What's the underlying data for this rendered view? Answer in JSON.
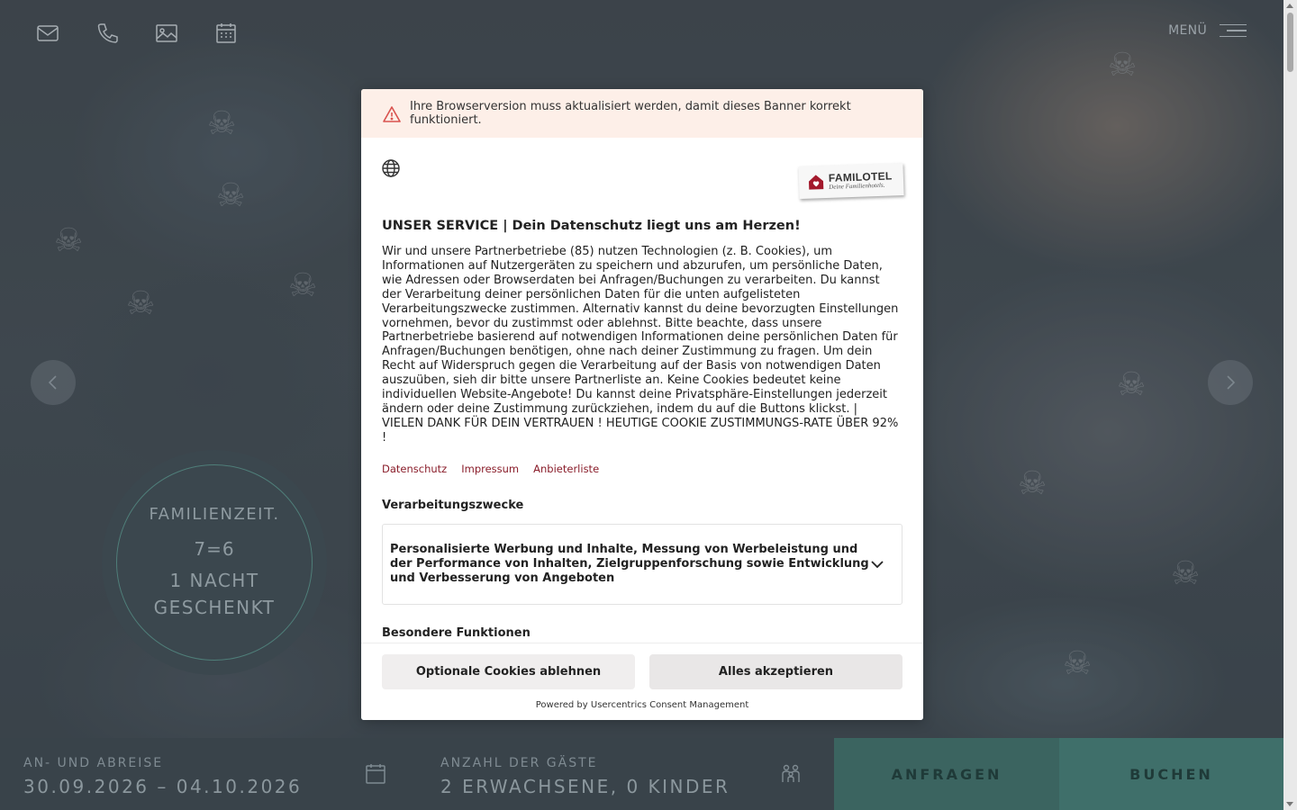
{
  "page": {
    "menu_label": "MENÜ"
  },
  "promo": {
    "title": "FAMILIENZEIT.",
    "equation": "7=6",
    "line1": "1 NACHT",
    "line2": "GESCHENKT"
  },
  "booking": {
    "dates_label": "AN- UND ABREISE",
    "dates_value": "30.09.2026 – 04.10.2026",
    "guests_label": "ANZAHL DER GÄSTE",
    "guests_value": "2 ERWACHSENE, 0 KINDER",
    "inquire_label": "ANFRAGEN",
    "book_label": "BUCHEN"
  },
  "consent": {
    "warning": "Ihre Browserversion muss aktualisiert werden, damit dieses Banner korrekt funktioniert.",
    "logo_name": "FAMILOTEL",
    "logo_tagline": "Deine Familienhotels.",
    "title": "UNSER SERVICE | Dein Datenschutz liegt uns am Herzen!",
    "text": "Wir und unsere Partnerbetriebe (85) nutzen Technologien (z. B. Cookies), um Informationen auf Nutzergeräten zu speichern und abzurufen, um persönliche Daten, wie Adressen oder Browserdaten bei Anfragen/Buchungen zu verarbeiten. Du kannst der Verarbeitung deiner persönlichen Daten für die unten aufgelisteten Verarbeitungszwecke zustimmen. Alternativ kannst du deine bevorzugten Einstellungen vornehmen, bevor du zustimmst oder ablehnst. Bitte beachte, dass unsere Partnerbetriebe basierend auf notwendigen Informationen deine persönlichen Daten für Anfragen/Buchungen benötigen, ohne nach deiner Zustimmung zu fragen. Um dein Recht auf Widerspruch gegen die Verarbeitung auf der Basis von notwendigen Daten auszuüben, sieh dir bitte unsere Partnerliste an. Keine Cookies bedeutet keine individuellen Website-Angebote! Du kannst deine Privatsphäre-Einstellungen jederzeit ändern oder deine Zustimmung zurückziehen, indem du auf die Buttons klickst. | VIELEN DANK FÜR DEIN VERTRAUEN ! HEUTIGE COOKIE ZUSTIMMUNGS-RATE ÜBER 92% !",
    "links": {
      "privacy": "Datenschutz",
      "imprint": "Impressum",
      "vendors": "Anbieterliste"
    },
    "purposes_heading": "Verarbeitungszwecke",
    "purpose_item": "Personalisierte Werbung und Inhalte, Messung von Werbeleistung und der Performance von Inhalten, Zielgruppenforschung sowie Entwicklung und Verbesserung von Angeboten",
    "special_heading": "Besondere Funktionen",
    "decline_label": "Optionale Cookies ablehnen",
    "accept_label": "Alles akzeptieren",
    "powered_by": "Powered by Usercentrics Consent Management"
  },
  "colors": {
    "accent_teal": "#3f6f6a",
    "link_red": "#8a1e2b",
    "warning_bg": "#fdefe8",
    "warning_icon": "#d9534f"
  },
  "icons": [
    "mail-icon",
    "phone-icon",
    "image-gallery-icon",
    "calendar-icon",
    "hamburger-menu-icon",
    "chevron-left-icon",
    "chevron-right-icon",
    "guests-icon",
    "warning-icon",
    "globe-icon",
    "chevron-down-icon"
  ]
}
